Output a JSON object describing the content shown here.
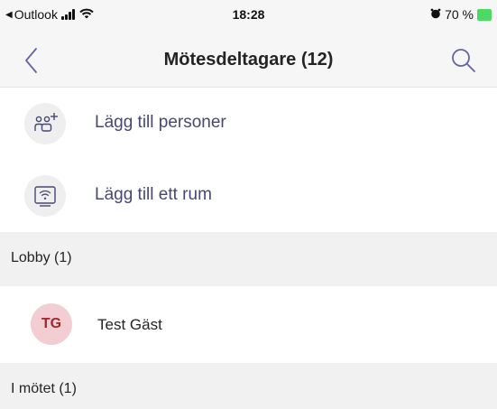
{
  "status_bar": {
    "carrier": "Outlook",
    "time": "18:28",
    "battery": "70 %"
  },
  "nav": {
    "title": "Mötesdeltagare (12)"
  },
  "actions": [
    {
      "label": "Lägg till personer",
      "icon": "add-people-icon"
    },
    {
      "label": "Lägg till ett rum",
      "icon": "room-icon"
    }
  ],
  "sections": {
    "lobby": "Lobby (1)",
    "in_meeting": "I mötet (1)"
  },
  "lobby_people": [
    {
      "initials": "TG",
      "name": "Test Gäst",
      "avatar_color": "#f2ced2",
      "initials_color": "#a4262c"
    }
  ],
  "colors": {
    "accent": "#464775",
    "header_bg": "#f6f6f6",
    "section_bg": "#f1f1f1"
  }
}
